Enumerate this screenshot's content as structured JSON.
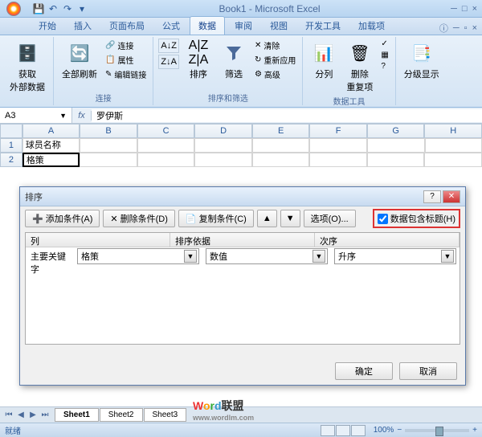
{
  "title": "Book1 - Microsoft Excel",
  "tabs": [
    "开始",
    "插入",
    "页面布局",
    "公式",
    "数据",
    "审阅",
    "视图",
    "开发工具",
    "加载项"
  ],
  "activeTab": 4,
  "ribbon": {
    "g1": {
      "btn": "获取\n外部数据"
    },
    "g2": {
      "btn": "全部刷新",
      "items": [
        "连接",
        "属性",
        "编辑链接"
      ],
      "label": "连接"
    },
    "g3": {
      "sort": "排序",
      "filter": "筛选",
      "items": [
        "清除",
        "重新应用",
        "高级"
      ],
      "label": "排序和筛选"
    },
    "g4": {
      "b1": "分列",
      "b2": "删除\n重复项",
      "label": "数据工具"
    },
    "g5": {
      "btn": "分级显示"
    }
  },
  "namebox": "A3",
  "formula": "罗伊斯",
  "cols": [
    "A",
    "B",
    "C",
    "D",
    "E",
    "F",
    "G",
    "H"
  ],
  "rows": [
    {
      "n": "1",
      "a": "球员名称"
    },
    {
      "n": "2",
      "a": "格策"
    }
  ],
  "dialog": {
    "title": "排序",
    "add": "添加条件(A)",
    "del": "删除条件(D)",
    "copy": "复制条件(C)",
    "opts": "选项(O)...",
    "header": "数据包含标题(H)",
    "headerChecked": true,
    "cols": [
      "列",
      "排序依据",
      "次序"
    ],
    "rowLabel": "主要关键字",
    "c1": "格策",
    "c2": "数值",
    "c3": "升序",
    "ok": "确定",
    "cancel": "取消"
  },
  "sheets": [
    "Sheet1",
    "Sheet2",
    "Sheet3"
  ],
  "status": {
    "ready": "就绪",
    "zoom": "100%"
  },
  "watermark": {
    "text": "Word联盟",
    "url": "www.wordlm.com"
  }
}
